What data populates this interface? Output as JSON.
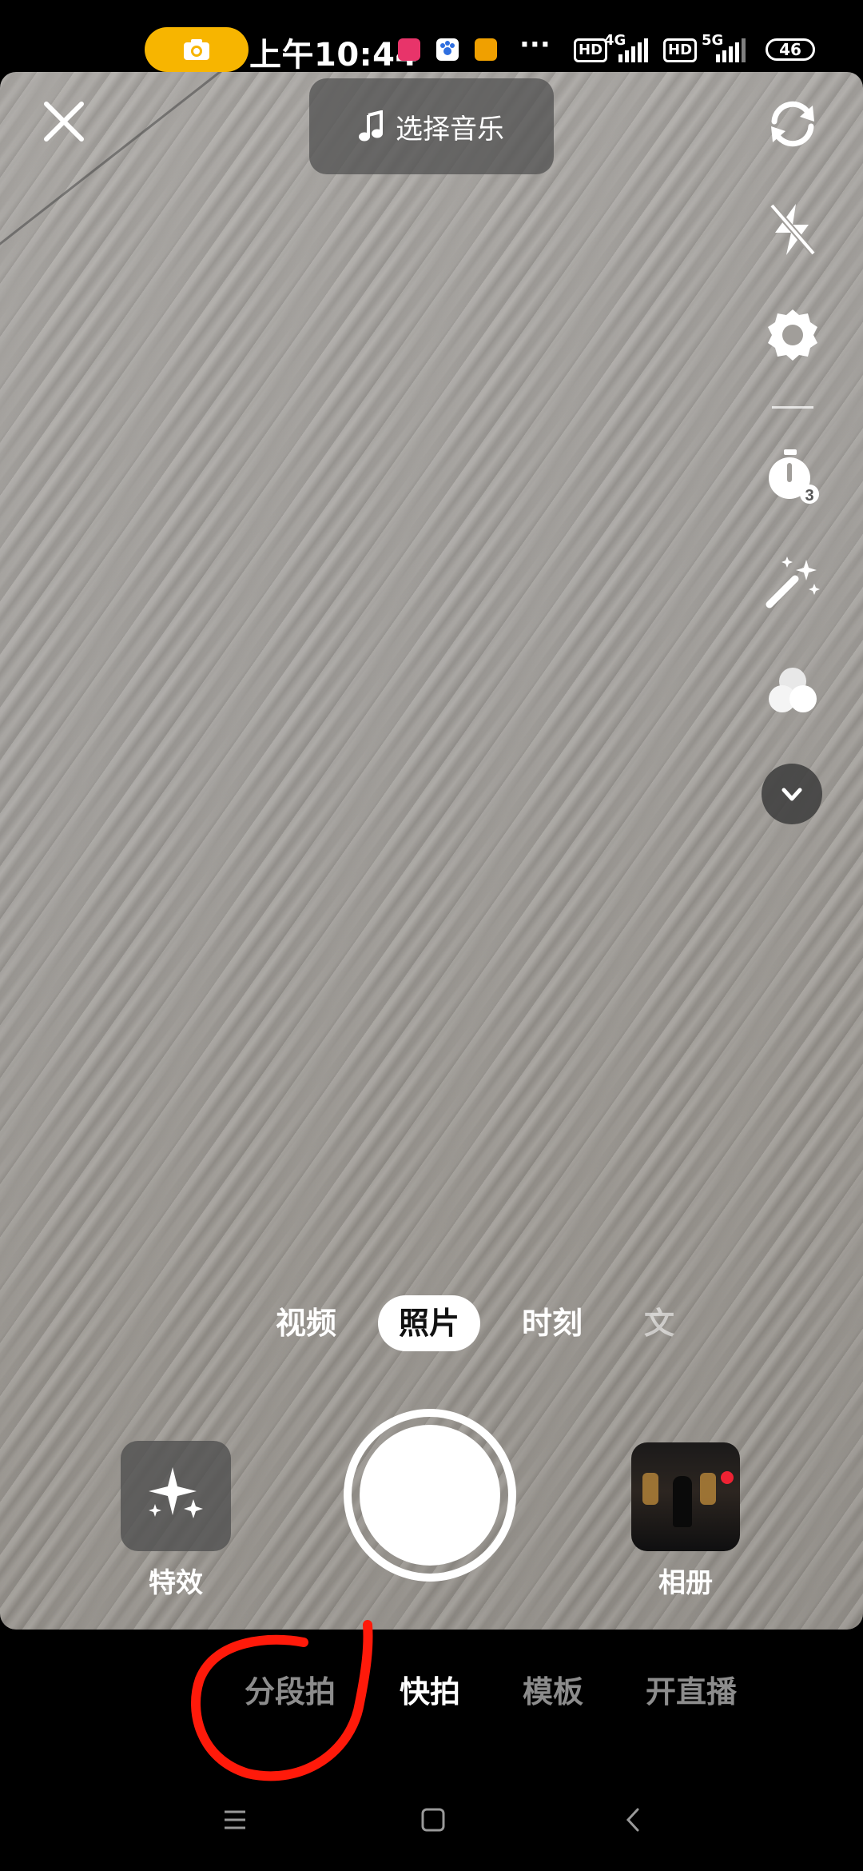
{
  "status_bar": {
    "time": "上午10:44",
    "more": "···",
    "hd1": "HD",
    "net1": "4G",
    "hd2": "HD",
    "net2": "5G",
    "battery": "46"
  },
  "top": {
    "music_label": "选择音乐"
  },
  "side_tools": [
    "camera-flip-icon",
    "flash-off-icon",
    "gear-icon",
    "timer-3s-icon",
    "magic-wand-icon",
    "filter-circles-icon",
    "chevron-down-icon"
  ],
  "capture_modes": {
    "items": [
      "视频",
      "照片",
      "时刻",
      "文"
    ],
    "selected": "照片"
  },
  "controls": {
    "effects_label": "特效",
    "album_label": "相册"
  },
  "bottom_modes": {
    "items": [
      "分段拍",
      "快拍",
      "模板",
      "开直播"
    ],
    "selected": "快拍"
  },
  "colors": {
    "camera_pill": "#f7b500",
    "annotation": "#ff1a0a"
  }
}
